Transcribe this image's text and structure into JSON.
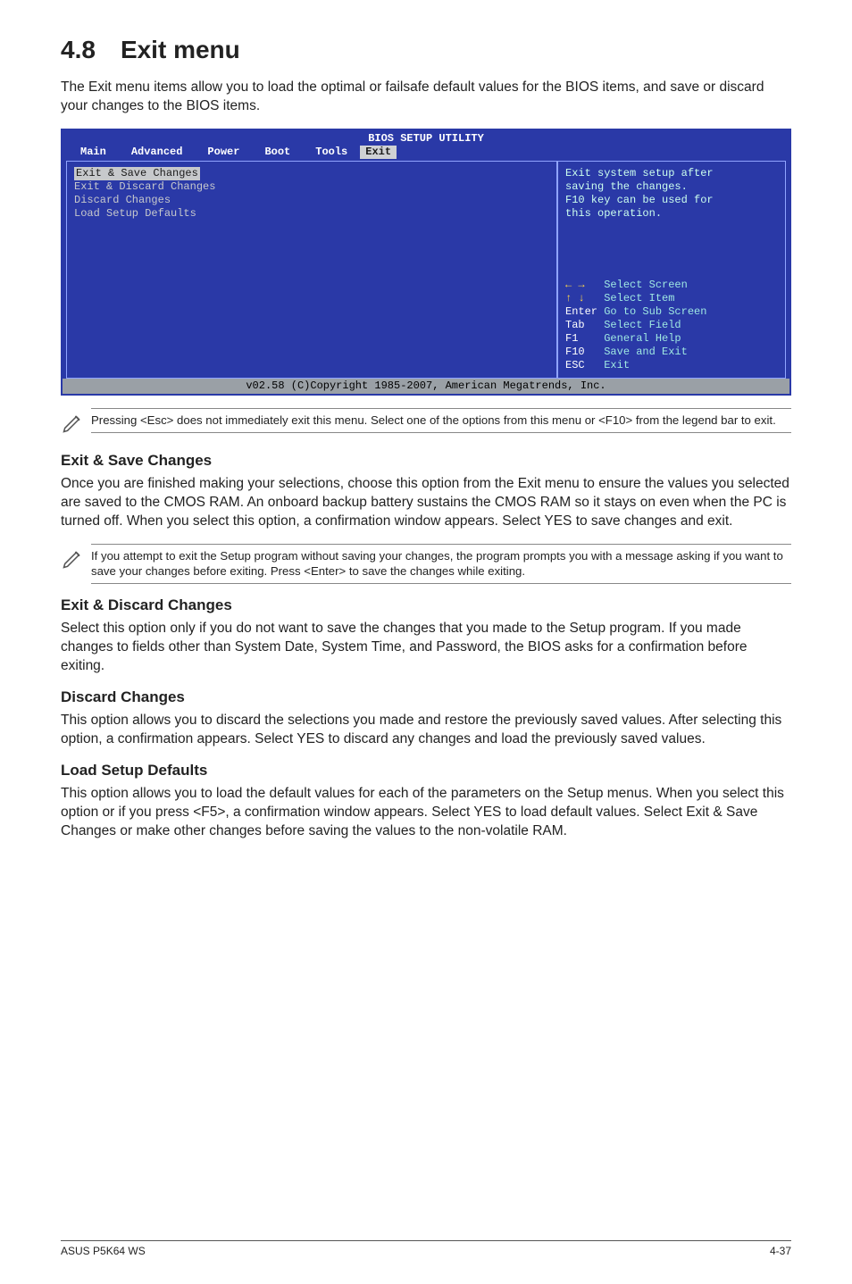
{
  "heading": {
    "num": "4.8",
    "title": "Exit menu"
  },
  "intro": "The Exit menu items allow you to load the optimal or failsafe default values for the BIOS items, and save or discard your changes to the BIOS items.",
  "bios": {
    "title": "BIOS SETUP UTILITY",
    "tabs": [
      "Main",
      "Advanced",
      "Power",
      "Boot",
      "Tools",
      "Exit"
    ],
    "selected_tab": "Exit",
    "menu": [
      "Exit & Save Changes",
      "Exit & Discard Changes",
      "Discard Changes",
      "",
      "Load Setup Defaults"
    ],
    "help_top": [
      "Exit system setup after",
      "saving the changes.",
      "",
      "F10 key can be used for",
      "this operation."
    ],
    "keys": [
      {
        "k": "← →",
        "d": "Select Screen"
      },
      {
        "k": "↑ ↓",
        "d": "Select Item"
      },
      {
        "k": "Enter",
        "d": "Go to Sub Screen"
      },
      {
        "k": "Tab",
        "d": "Select Field"
      },
      {
        "k": "F1",
        "d": "General Help"
      },
      {
        "k": "F10",
        "d": "Save and Exit"
      },
      {
        "k": "ESC",
        "d": "Exit"
      }
    ],
    "footer": "v02.58 (C)Copyright 1985-2007, American Megatrends, Inc."
  },
  "note1": "Pressing <Esc> does not immediately exit this menu. Select one of the options from this menu or <F10> from the legend bar to exit.",
  "sections": {
    "save_h": "Exit & Save Changes",
    "save_p": "Once you are finished making your selections, choose this option from the Exit menu to ensure the values you selected are saved to the CMOS RAM. An onboard backup battery sustains the CMOS RAM so it stays on even when the PC is turned off. When you select this option, a confirmation window appears. Select YES to save changes and exit.",
    "note2": "If you attempt to exit the Setup program without saving your changes, the program prompts you with a message asking if you want to save your changes before exiting. Press <Enter> to save the changes while exiting.",
    "disc_h": "Exit & Discard Changes",
    "disc_p": "Select this option only if you do not want to save the changes that you  made to the Setup program. If you made changes to fields other than System Date, System Time, and Password, the BIOS asks for a confirmation before exiting.",
    "dch_h": "Discard Changes",
    "dch_p": "This option allows you to discard the selections you made and restore the previously saved values. After selecting this option, a confirmation appears. Select YES to discard any changes and load the previously saved values.",
    "lsd_h": "Load Setup Defaults",
    "lsd_p": "This option allows you to load the default values for each of the parameters on the Setup menus. When you select this option or if you press <F5>, a confirmation window appears. Select YES to load default values. Select Exit & Save Changes or make other changes before saving the values to the non-volatile RAM."
  },
  "footer": {
    "left": "ASUS P5K64 WS",
    "right": "4-37"
  }
}
